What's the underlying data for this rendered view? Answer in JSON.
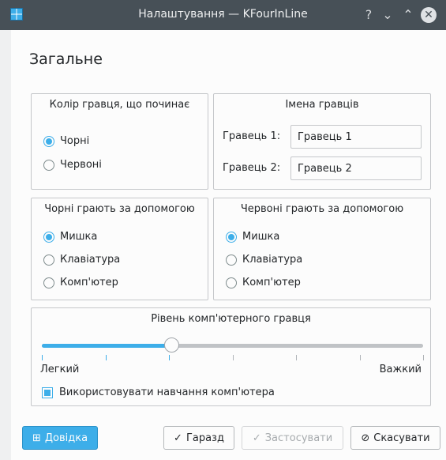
{
  "window": {
    "title": "Налаштування — KFourInLine",
    "controls": {
      "help": "?",
      "minimize": "⌄",
      "maximize": "⌃",
      "close": "✕"
    }
  },
  "page": {
    "title": "Загальне"
  },
  "starting_color": {
    "title": "Колір гравця, що починає",
    "options": [
      {
        "label": "Чорні",
        "checked": true
      },
      {
        "label": "Червоні",
        "checked": false
      }
    ]
  },
  "player_names": {
    "title": "Імена гравців",
    "player1": {
      "label": "Гравець 1:",
      "value": "Гравець 1"
    },
    "player2": {
      "label": "Гравець 2:",
      "value": "Гравець 2"
    }
  },
  "black_input": {
    "title": "Чорні грають за допомогою",
    "options": [
      {
        "label": "Мишка",
        "checked": true
      },
      {
        "label": "Клавіатура",
        "checked": false
      },
      {
        "label": "Комп'ютер",
        "checked": false
      }
    ]
  },
  "red_input": {
    "title": "Червоні грають за допомогою",
    "options": [
      {
        "label": "Мишка",
        "checked": true
      },
      {
        "label": "Клавіатура",
        "checked": false
      },
      {
        "label": "Комп'ютер",
        "checked": false
      }
    ]
  },
  "computer_level": {
    "title": "Рівень комп'ютерного гравця",
    "min_label": "Легкий",
    "max_label": "Важкий",
    "level_fraction": 0.34,
    "tick_count": 7,
    "learning": {
      "label": "Використовувати навчання комп'ютера",
      "checked": true
    }
  },
  "buttons": {
    "help": "Довідка",
    "ok": "Гаразд",
    "apply": "Застосувати",
    "cancel": "Скасувати"
  },
  "colors": {
    "accent": "#3daee9",
    "titlebar": "#475057",
    "background": "#fcfcfc"
  }
}
